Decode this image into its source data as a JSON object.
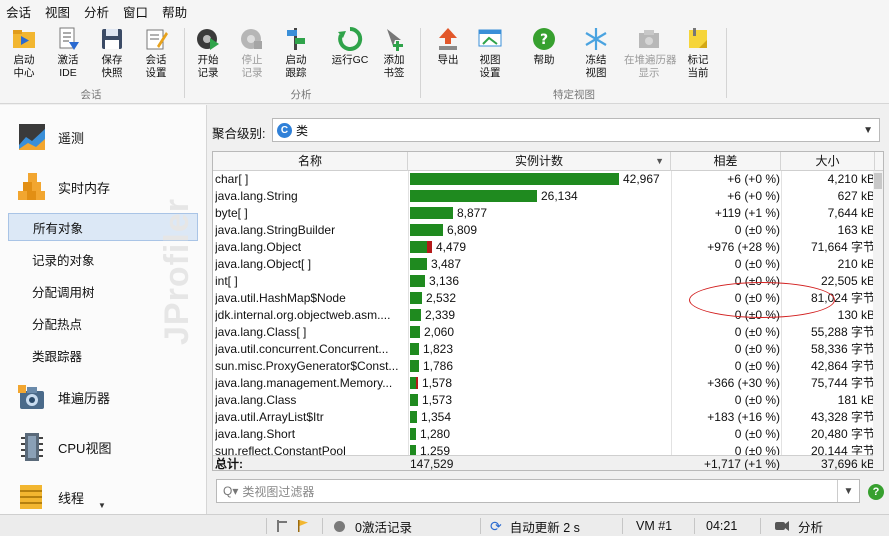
{
  "menu": [
    "会话",
    "视图",
    "分析",
    "窗口",
    "帮助"
  ],
  "toolbar": {
    "groups": [
      {
        "name": "会话",
        "buttons": [
          {
            "label1": "启动",
            "label2": "中心",
            "icon": "folder-play-icon"
          },
          {
            "label1": "激活",
            "label2": "IDE",
            "icon": "ide-icon"
          },
          {
            "label1": "保存",
            "label2": "快照",
            "icon": "save-icon"
          },
          {
            "label1": "会话",
            "label2": "设置",
            "icon": "settings-icon"
          }
        ]
      },
      {
        "name": "分析",
        "buttons": [
          {
            "label1": "开始",
            "label2": "记录",
            "icon": "record-icon"
          },
          {
            "label1": "停止",
            "label2": "记录",
            "icon": "stop-record-icon",
            "disabled": true
          },
          {
            "label1": "启动",
            "label2": "跟踪",
            "icon": "tracking-icon"
          },
          {
            "label1": "运行GC",
            "label2": "",
            "icon": "gc-icon"
          },
          {
            "label1": "添加",
            "label2": "书签",
            "icon": "bookmark-icon"
          }
        ]
      },
      {
        "name": "特定视图",
        "buttons": [
          {
            "label1": "导出",
            "label2": "",
            "icon": "export-icon"
          },
          {
            "label1": "视图",
            "label2": "设置",
            "icon": "view-settings-icon"
          },
          {
            "label1": "帮助",
            "label2": "",
            "icon": "help-icon"
          },
          {
            "label1": "冻结",
            "label2": "视图",
            "icon": "freeze-icon"
          },
          {
            "label1": "在堆遍历器",
            "label2": "显示",
            "icon": "heap-walker-show-icon",
            "disabled": true
          },
          {
            "label1": "标记",
            "label2": "当前",
            "icon": "mark-icon"
          }
        ]
      }
    ]
  },
  "nav": {
    "telemetry": "遥测",
    "live_memory": "实时内存",
    "sub": [
      "所有对象",
      "记录的对象",
      "分配调用树",
      "分配热点",
      "类跟踪器"
    ],
    "selected_sub": "所有对象",
    "heap_walker": "堆遍历器",
    "cpu_view": "CPU视图",
    "threads": "线程",
    "watermark": "JProfiler"
  },
  "aggregation": {
    "label": "聚合级别:",
    "value": "类"
  },
  "table": {
    "columns": [
      "名称",
      "实例计数",
      "相差",
      "大小"
    ],
    "rows": [
      {
        "name": "char[ ]",
        "count": 42967,
        "count_text": "42,967",
        "diff": "+6 (+0 %)",
        "size": "4,210 kB",
        "red": 0
      },
      {
        "name": "java.lang.String",
        "count": 26134,
        "count_text": "26,134",
        "diff": "+6 (+0 %)",
        "size": "627 kB",
        "red": 0
      },
      {
        "name": "byte[ ]",
        "count": 8877,
        "count_text": "8,877",
        "diff": "+119 (+1 %)",
        "size": "7,644 kB",
        "red": 0
      },
      {
        "name": "java.lang.StringBuilder",
        "count": 6809,
        "count_text": "6,809",
        "diff": "0 (±0 %)",
        "size": "163 kB",
        "red": 0
      },
      {
        "name": "java.lang.Object",
        "count": 4479,
        "count_text": "4,479",
        "diff": "+976 (+28 %)",
        "size": "71,664 字节",
        "red": 976
      },
      {
        "name": "java.lang.Object[ ]",
        "count": 3487,
        "count_text": "3,487",
        "diff": "0 (±0 %)",
        "size": "210 kB",
        "red": 0
      },
      {
        "name": "int[ ]",
        "count": 3136,
        "count_text": "3,136",
        "diff": "0 (±0 %)",
        "size": "22,505 kB",
        "red": 0
      },
      {
        "name": "java.util.HashMap$Node",
        "count": 2532,
        "count_text": "2,532",
        "diff": "0 (±0 %)",
        "size": "81,024 字节",
        "red": 0
      },
      {
        "name": "jdk.internal.org.objectweb.asm....",
        "count": 2339,
        "count_text": "2,339",
        "diff": "0 (±0 %)",
        "size": "130 kB",
        "red": 0
      },
      {
        "name": "java.lang.Class[ ]",
        "count": 2060,
        "count_text": "2,060",
        "diff": "0 (±0 %)",
        "size": "55,288 字节",
        "red": 0
      },
      {
        "name": "java.util.concurrent.Concurrent...",
        "count": 1823,
        "count_text": "1,823",
        "diff": "0 (±0 %)",
        "size": "58,336 字节",
        "red": 0
      },
      {
        "name": "sun.misc.ProxyGenerator$Const...",
        "count": 1786,
        "count_text": "1,786",
        "diff": "0 (±0 %)",
        "size": "42,864 字节",
        "red": 0
      },
      {
        "name": "java.lang.management.Memory...",
        "count": 1578,
        "count_text": "1,578",
        "diff": "+366 (+30 %)",
        "size": "75,744 字节",
        "red": 366
      },
      {
        "name": "java.lang.Class",
        "count": 1573,
        "count_text": "1,573",
        "diff": "0 (±0 %)",
        "size": "181 kB",
        "red": 0
      },
      {
        "name": "java.util.ArrayList$Itr",
        "count": 1354,
        "count_text": "1,354",
        "diff": "+183 (+16 %)",
        "size": "43,328 字节",
        "red": 0
      },
      {
        "name": "java.lang.Short",
        "count": 1280,
        "count_text": "1,280",
        "diff": "0 (±0 %)",
        "size": "20,480 字节",
        "red": 0
      },
      {
        "name": "sun.reflect.ConstantPool",
        "count": 1259,
        "count_text": "1,259",
        "diff": "0 (±0 %)",
        "size": "20,144 字节",
        "red": 0
      }
    ],
    "total": {
      "label": "总计:",
      "count": "147,529",
      "diff": "+1,717 (+1 %)",
      "size": "37,696 kB"
    }
  },
  "filter": {
    "placeholder": "类视图过滤器"
  },
  "status": {
    "records": "0激活记录",
    "auto_update": "自动更新 2 s",
    "vm": "VM #1",
    "time": "04:21",
    "mode": "分析"
  },
  "colors": {
    "bar": "#1f8a1f",
    "bar_delta": "#b41a1a",
    "selection": "#dce8f6",
    "annotation": "#d21f1f"
  }
}
